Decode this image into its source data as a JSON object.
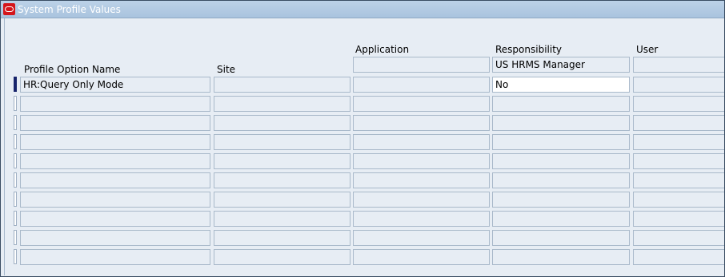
{
  "window": {
    "title": "System Profile Values"
  },
  "headers": {
    "profile_option_name": "Profile Option Name",
    "site": "Site",
    "application": "Application",
    "responsibility": "Responsibility",
    "user": "User"
  },
  "responsibility_context": "US HRMS Manager",
  "application_context": "",
  "user_context": "",
  "rows": [
    {
      "profile": "HR:Query Only Mode",
      "site": "",
      "application": "",
      "responsibility": "No",
      "user": ""
    },
    {
      "profile": "",
      "site": "",
      "application": "",
      "responsibility": "",
      "user": ""
    },
    {
      "profile": "",
      "site": "",
      "application": "",
      "responsibility": "",
      "user": ""
    },
    {
      "profile": "",
      "site": "",
      "application": "",
      "responsibility": "",
      "user": ""
    },
    {
      "profile": "",
      "site": "",
      "application": "",
      "responsibility": "",
      "user": ""
    },
    {
      "profile": "",
      "site": "",
      "application": "",
      "responsibility": "",
      "user": ""
    },
    {
      "profile": "",
      "site": "",
      "application": "",
      "responsibility": "",
      "user": ""
    },
    {
      "profile": "",
      "site": "",
      "application": "",
      "responsibility": "",
      "user": ""
    },
    {
      "profile": "",
      "site": "",
      "application": "",
      "responsibility": "",
      "user": ""
    },
    {
      "profile": "",
      "site": "",
      "application": "",
      "responsibility": "",
      "user": ""
    }
  ]
}
